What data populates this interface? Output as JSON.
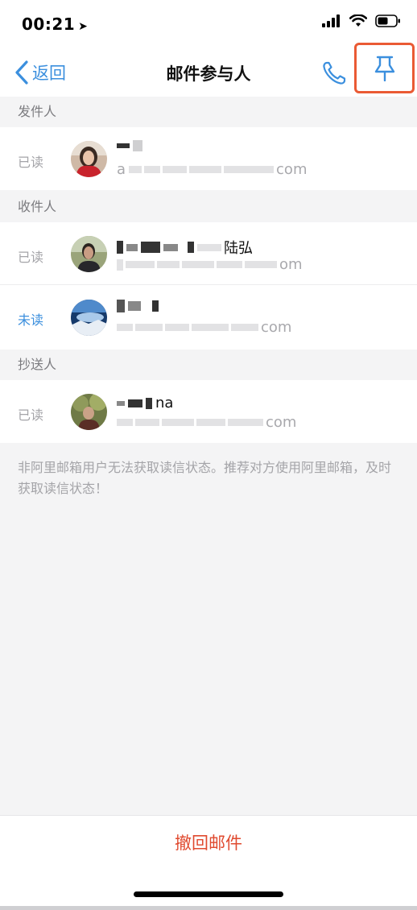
{
  "status_bar": {
    "time": "00:21",
    "location_glyph": "➤"
  },
  "nav": {
    "back_label": "返回",
    "title": "邮件参与人",
    "phone_icon": "phone-icon",
    "pin_icon": "pin-icon",
    "highlight_color": "#ea5a34"
  },
  "sections": {
    "sender": "发件人",
    "recipients": "收件人",
    "cc": "抄送人"
  },
  "participants": [
    {
      "role": "sender",
      "status": "已读",
      "name_suffix": "",
      "email_prefix": "a",
      "email_suffix": "com"
    },
    {
      "role": "recipient",
      "status": "已读",
      "name_suffix": "陆弘",
      "email_prefix": "",
      "email_suffix": "om"
    },
    {
      "role": "recipient",
      "status": "未读",
      "name_suffix": "",
      "email_prefix": "",
      "email_suffix": "com"
    },
    {
      "role": "cc",
      "status": "已读",
      "name_suffix": "na",
      "email_prefix": "",
      "email_suffix": "com"
    }
  ],
  "notice": "非阿里邮箱用户无法获取读信状态。推荐对方使用阿里邮箱，及时获取读信状态！",
  "bottom": {
    "recall_label": "撤回邮件"
  },
  "colors": {
    "accent_blue": "#3b8fde",
    "recall_red": "#e04a2f",
    "background": "#f4f4f5"
  }
}
